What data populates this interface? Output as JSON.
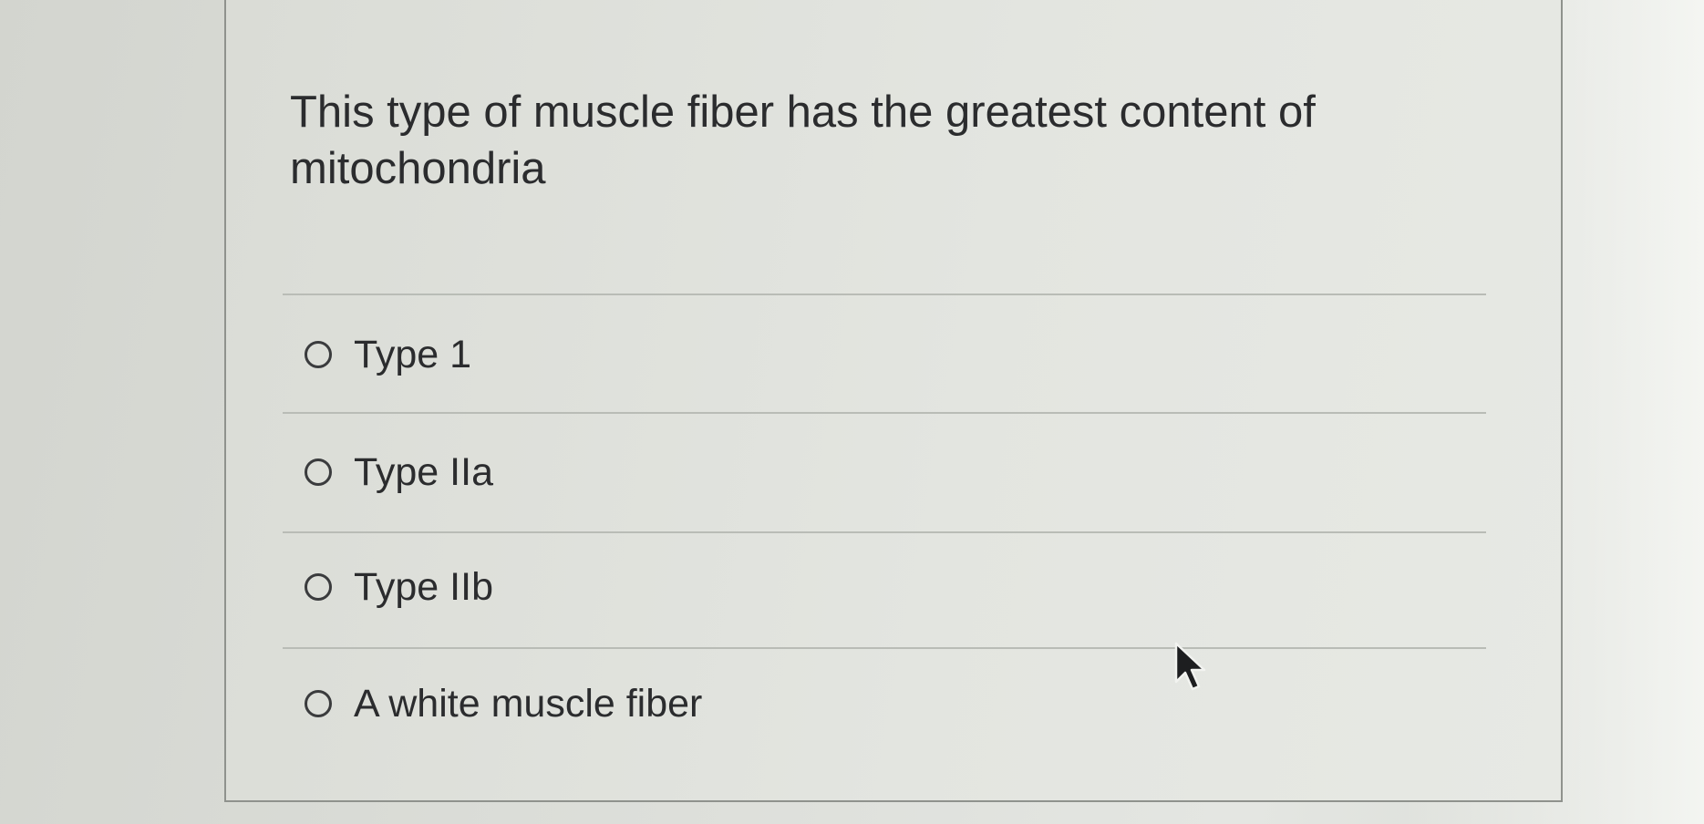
{
  "question": {
    "text": "This type of muscle fiber has the greatest content of mitochondria"
  },
  "options": [
    {
      "label": "Type 1",
      "selected": false
    },
    {
      "label": "Type IIa",
      "selected": false
    },
    {
      "label": "Type IIb",
      "selected": false
    },
    {
      "label": "A white muscle fiber",
      "selected": false
    }
  ],
  "icons": {
    "radio": "radio-unchecked-icon",
    "cursor": "mouse-pointer-icon"
  },
  "colors": {
    "text": "#2b2c2e",
    "card_border": "#8f928d",
    "divider": "#b9bcb6"
  }
}
